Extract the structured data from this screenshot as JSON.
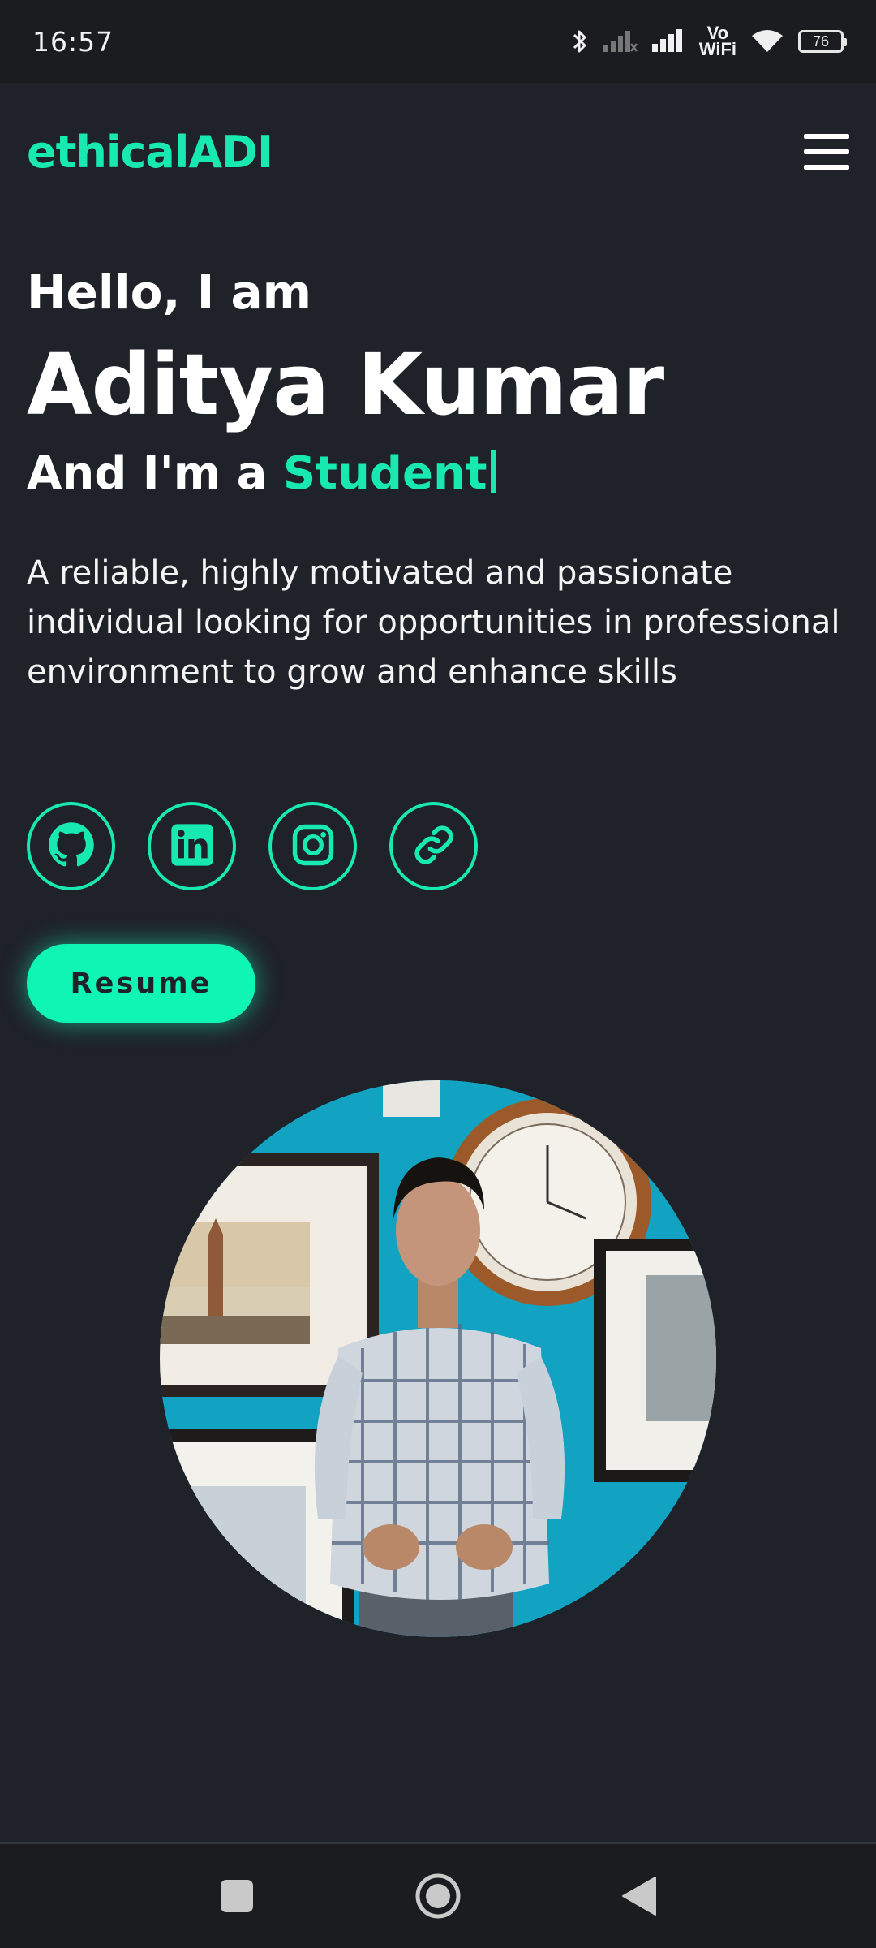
{
  "status_bar": {
    "time": "16:57",
    "vowifi_top": "Vo",
    "vowifi_bottom": "WiFi",
    "battery": "76",
    "icons": [
      "bluetooth-icon",
      "signal-weak-icon",
      "signal-strong-icon",
      "wifi-icon",
      "battery-icon"
    ]
  },
  "header": {
    "logo": "ethicalADI",
    "menu_icon": "hamburger-menu-icon"
  },
  "hero": {
    "greeting": "Hello, I am",
    "name": "Aditya Kumar",
    "role_prefix": "And I'm a ",
    "role_value": "Student",
    "description": "A reliable, highly motivated and passionate individual looking for opportunities in professional environment to grow and enhance skills"
  },
  "socials": [
    {
      "icon": "github-icon"
    },
    {
      "icon": "linkedin-icon"
    },
    {
      "icon": "instagram-icon"
    },
    {
      "icon": "link-icon"
    }
  ],
  "resume_button": "Resume",
  "navbar": {
    "icons": [
      "recents-square-icon",
      "home-circle-icon",
      "back-triangle-icon"
    ]
  },
  "colors": {
    "accent": "#18e9b0",
    "background": "#1f2229",
    "status_bar": "#1b1c20",
    "portrait_wall": "#11a3c3"
  }
}
